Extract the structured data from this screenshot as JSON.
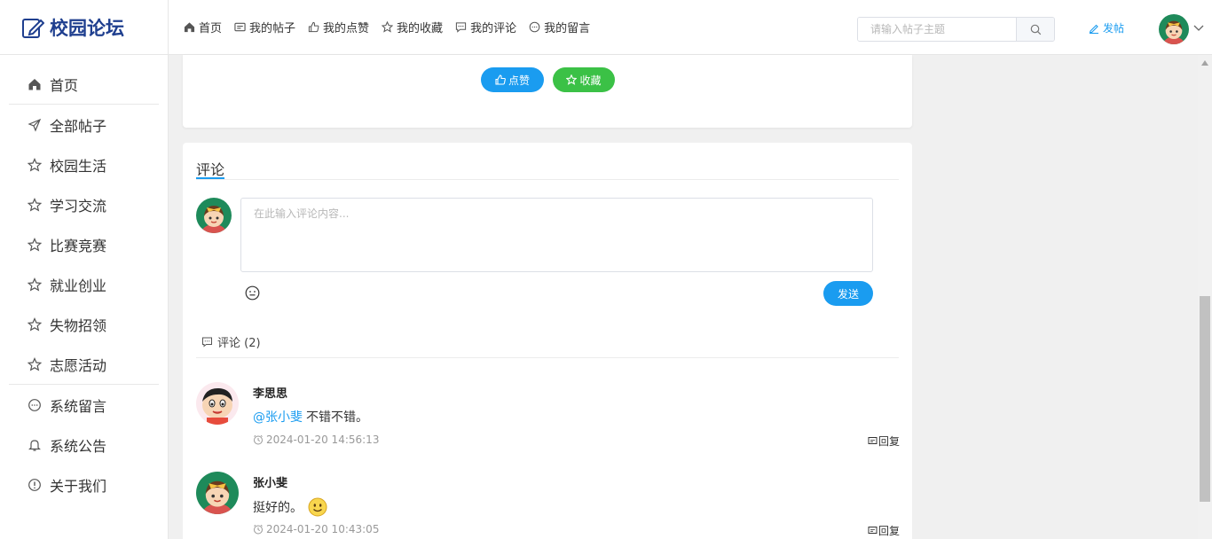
{
  "header": {
    "logo_text": "校园论坛",
    "nav": [
      {
        "label": "首页",
        "icon": "home-icon"
      },
      {
        "label": "我的帖子",
        "icon": "post-icon"
      },
      {
        "label": "我的点赞",
        "icon": "thumb-up-icon"
      },
      {
        "label": "我的收藏",
        "icon": "star-icon"
      },
      {
        "label": "我的评论",
        "icon": "comment-icon"
      },
      {
        "label": "我的留言",
        "icon": "message-icon"
      }
    ],
    "search_placeholder": "请输入帖子主题",
    "post_label": "发帖"
  },
  "sidebar": {
    "items": [
      {
        "label": "首页",
        "icon": "home-icon"
      },
      {
        "label": "全部帖子",
        "icon": "send-icon"
      },
      {
        "label": "校园生活",
        "icon": "star-icon"
      },
      {
        "label": "学习交流",
        "icon": "star-icon"
      },
      {
        "label": "比赛竞赛",
        "icon": "star-icon"
      },
      {
        "label": "就业创业",
        "icon": "star-icon"
      },
      {
        "label": "失物招领",
        "icon": "star-icon"
      },
      {
        "label": "志愿活动",
        "icon": "star-icon"
      },
      {
        "label": "系统留言",
        "icon": "message-icon"
      },
      {
        "label": "系统公告",
        "icon": "bell-icon"
      },
      {
        "label": "关于我们",
        "icon": "info-icon"
      }
    ]
  },
  "post_actions": {
    "like_label": "点赞",
    "favorite_label": "收藏"
  },
  "comments_section": {
    "title": "评论",
    "input_placeholder": "在此输入评论内容...",
    "send_label": "发送",
    "count_label": "评论 (2)",
    "reply_label": "回复",
    "items": [
      {
        "author": "李思思",
        "mention": "@张小斐",
        "text": "不错不错。",
        "time": "2024-01-20 14:56:13",
        "has_emoji": false
      },
      {
        "author": "张小斐",
        "mention": "",
        "text": "挺好的。",
        "time": "2024-01-20 10:43:05",
        "has_emoji": true
      }
    ]
  },
  "colors": {
    "primary": "#1a9cf0",
    "favorite": "#3bc146",
    "logo": "#1f3f8f"
  }
}
